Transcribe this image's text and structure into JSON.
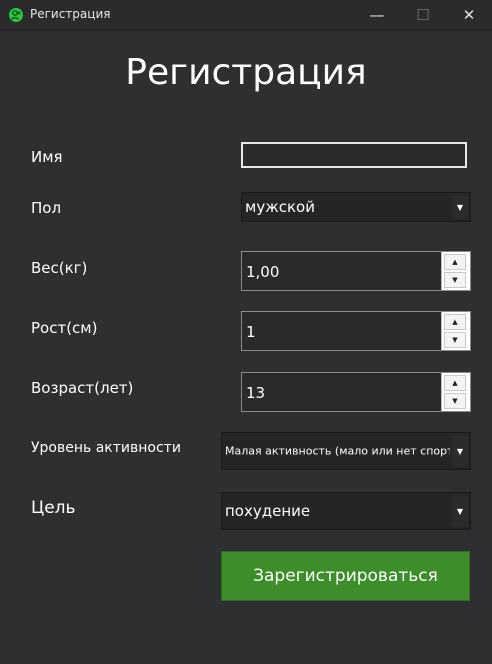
{
  "window": {
    "title": "Регистрация",
    "minimize_label": "—",
    "maximize_label": "☐",
    "close_label": "✕"
  },
  "form": {
    "heading": "Регистрация",
    "name": {
      "label": "Имя",
      "value": ""
    },
    "gender": {
      "label": "Пол",
      "value": "мужской"
    },
    "weight": {
      "label": "Вес(кг)",
      "value": "1,00"
    },
    "height": {
      "label": "Рост(см)",
      "value": "1"
    },
    "age": {
      "label": "Возраст(лет)",
      "value": "13"
    },
    "activity": {
      "label": "Уровень активности",
      "value": "Малая активность (мало или нет спорта"
    },
    "goal": {
      "label": "Цель",
      "value": "похудение"
    },
    "submit_label": "Зарегистрироваться"
  },
  "icons": {
    "app": "user-add-icon",
    "combo_arrow": "▼",
    "spin_up": "▲",
    "spin_down": "▼"
  },
  "colors": {
    "background": "#2e2f30",
    "accent_button": "#3d8d2b",
    "app_icon": "#27c93f"
  }
}
